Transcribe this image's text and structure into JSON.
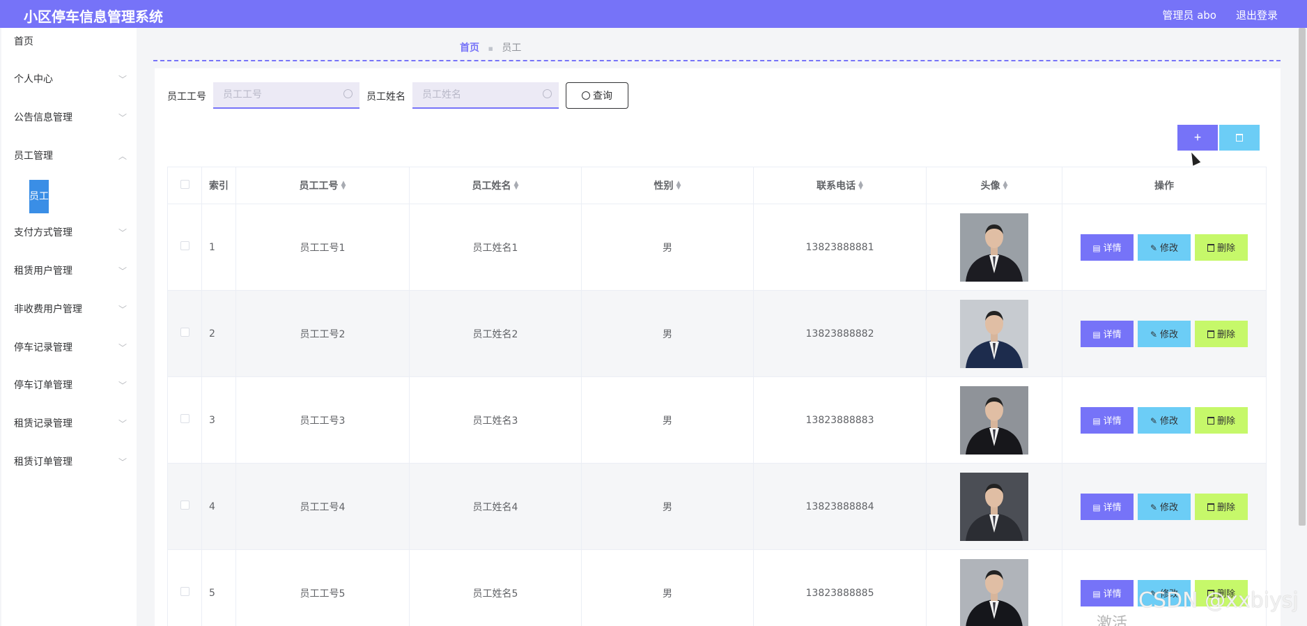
{
  "header": {
    "title": "小区停车信息管理系统",
    "admin": "管理员 abo",
    "logout": "退出登录"
  },
  "sidebar": {
    "items": [
      {
        "label": "首页",
        "chevron": ""
      },
      {
        "label": "个人中心",
        "chevron": "﹀"
      },
      {
        "label": "公告信息管理",
        "chevron": "﹀"
      },
      {
        "label": "员工管理",
        "chevron": "︿"
      },
      {
        "label": "支付方式管理",
        "chevron": "﹀"
      },
      {
        "label": "租赁用户管理",
        "chevron": "﹀"
      },
      {
        "label": "非收费用户管理",
        "chevron": "﹀"
      },
      {
        "label": "停车记录管理",
        "chevron": "﹀"
      },
      {
        "label": "停车订单管理",
        "chevron": "﹀"
      },
      {
        "label": "租赁记录管理",
        "chevron": "﹀"
      },
      {
        "label": "租赁订单管理",
        "chevron": "﹀"
      }
    ],
    "active_sub": "员工"
  },
  "breadcrumb": {
    "home": "首页",
    "current": "员工"
  },
  "search": {
    "id_label": "员工工号",
    "id_placeholder": "员工工号",
    "name_label": "员工姓名",
    "name_placeholder": "员工姓名",
    "query": "查询"
  },
  "toolbar": {
    "add": "+"
  },
  "table": {
    "headers": {
      "index": "索引",
      "id": "员工工号",
      "name": "员工姓名",
      "gender": "性别",
      "phone": "联系电话",
      "avatar": "头像",
      "ops": "操作"
    },
    "rows": [
      {
        "index": "1",
        "id": "员工工号1",
        "name": "员工姓名1",
        "gender": "男",
        "phone": "13823888881",
        "suit": "#1c1c22",
        "bg": "#9aa0a6"
      },
      {
        "index": "2",
        "id": "员工工号2",
        "name": "员工姓名2",
        "gender": "男",
        "phone": "13823888882",
        "suit": "#1d2c4d",
        "bg": "#c7cbd0"
      },
      {
        "index": "3",
        "id": "员工工号3",
        "name": "员工姓名3",
        "gender": "男",
        "phone": "13823888883",
        "suit": "#17171b",
        "bg": "#8f9399"
      },
      {
        "index": "4",
        "id": "员工工号4",
        "name": "员工姓名4",
        "gender": "男",
        "phone": "13823888884",
        "suit": "#2b2d33",
        "bg": "#4b4e55"
      },
      {
        "index": "5",
        "id": "员工工号5",
        "name": "员工姓名5",
        "gender": "男",
        "phone": "13823888885",
        "suit": "#15161b",
        "bg": "#b0b4ba"
      }
    ],
    "ops": {
      "detail": "详情",
      "edit": "修改",
      "delete": "删除"
    }
  },
  "watermark": {
    "line1": "CSDN @xxbiysj",
    "line2": "激活"
  },
  "colors": {
    "accent": "#7673f8",
    "edit": "#6ccdf6",
    "delete": "#c6f86a",
    "active": "#3a8ee6"
  }
}
